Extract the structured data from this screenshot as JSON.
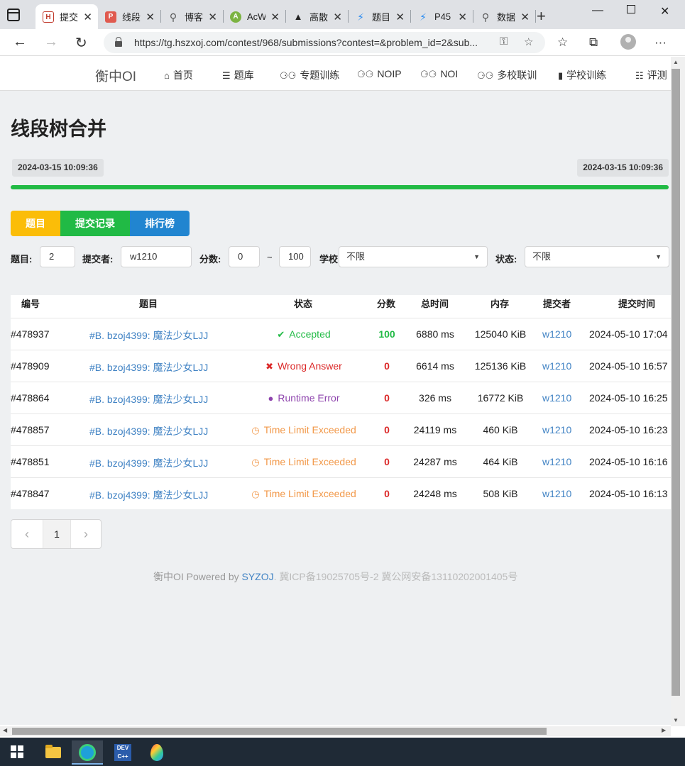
{
  "browser": {
    "tabs": [
      {
        "label": "提交",
        "favicon_color": "#c0392b"
      },
      {
        "label": "线段",
        "favicon_color": "#e05a4f"
      },
      {
        "label": "博客",
        "favicon_color": "#555555"
      },
      {
        "label": "AcW",
        "favicon_color": "#7cb342"
      },
      {
        "label": "高散",
        "favicon_color": "#222222"
      },
      {
        "label": "题目",
        "favicon_color": "#2d8cf0"
      },
      {
        "label": "P45",
        "favicon_color": "#2d8cf0"
      },
      {
        "label": "数据",
        "favicon_color": "#555555"
      }
    ],
    "url": "https://tg.hszxoj.com/contest/968/submissions?contest=&problem_id=2&sub..."
  },
  "site": {
    "brand": "衡中OI",
    "nav": [
      {
        "label": "首页",
        "icon": "home-icon"
      },
      {
        "label": "题库",
        "icon": "list-icon"
      },
      {
        "label": "专题训练",
        "icon": "bicycle-icon"
      },
      {
        "label": "NOIP",
        "icon": "bicycle-icon"
      },
      {
        "label": "NOI",
        "icon": "bicycle-icon"
      },
      {
        "label": "多校联训",
        "icon": "bicycle-icon"
      },
      {
        "label": "学校训练",
        "icon": "building-icon"
      },
      {
        "label": "评测",
        "icon": "tasks-icon"
      }
    ]
  },
  "contest": {
    "title": "线段树合并",
    "start_time": "2024-03-15 10:09:36",
    "end_time": "2024-03-15 10:09:36",
    "progress": 1.0
  },
  "tabs": {
    "problems": "题目",
    "submissions": "提交记录",
    "ranklist": "排行榜"
  },
  "filters": {
    "problem_label": "题目:",
    "problem_value": "2",
    "submitter_label": "提交者:",
    "submitter_value": "w1210",
    "score_label": "分数:",
    "score_min": "0",
    "score_sep": "~",
    "score_max": "100",
    "school_label": "学校",
    "school_value": "不限",
    "status_label": "状态:",
    "status_value": "不限"
  },
  "table": {
    "headers": {
      "id": "编号",
      "problem": "题目",
      "status": "状态",
      "score": "分数",
      "time": "总时间",
      "memory": "内存",
      "submitter": "提交者",
      "submit_time": "提交时间"
    },
    "rows": [
      {
        "id": "#478937",
        "problem": "#B. bzoj4399: 魔法少女LJJ",
        "status": "Accepted",
        "status_color": "#21ba45",
        "status_icon": "check-icon",
        "score": "100",
        "score_color": "#21ba45",
        "time": "6880 ms",
        "memory": "125040 KiB",
        "submitter": "w1210",
        "submit_time": "2024-05-10 17:04"
      },
      {
        "id": "#478909",
        "problem": "#B. bzoj4399: 魔法少女LJJ",
        "status": "Wrong Answer",
        "status_color": "#db2828",
        "status_icon": "cross-icon",
        "score": "0",
        "score_color": "#db2828",
        "time": "6614 ms",
        "memory": "125136 KiB",
        "submitter": "w1210",
        "submit_time": "2024-05-10 16:57"
      },
      {
        "id": "#478864",
        "problem": "#B. bzoj4399: 魔法少女LJJ",
        "status": "Runtime Error",
        "status_color": "#8e44ad",
        "status_icon": "bomb-icon",
        "score": "0",
        "score_color": "#db2828",
        "time": "326 ms",
        "memory": "16772 KiB",
        "submitter": "w1210",
        "submit_time": "2024-05-10 16:25"
      },
      {
        "id": "#478857",
        "problem": "#B. bzoj4399: 魔法少女LJJ",
        "status": "Time Limit Exceeded",
        "status_color": "#f2994a",
        "status_icon": "clock-icon",
        "score": "0",
        "score_color": "#db2828",
        "time": "24119 ms",
        "memory": "460 KiB",
        "submitter": "w1210",
        "submit_time": "2024-05-10 16:23"
      },
      {
        "id": "#478851",
        "problem": "#B. bzoj4399: 魔法少女LJJ",
        "status": "Time Limit Exceeded",
        "status_color": "#f2994a",
        "status_icon": "clock-icon",
        "score": "0",
        "score_color": "#db2828",
        "time": "24287 ms",
        "memory": "464 KiB",
        "submitter": "w1210",
        "submit_time": "2024-05-10 16:16"
      },
      {
        "id": "#478847",
        "problem": "#B. bzoj4399: 魔法少女LJJ",
        "status": "Time Limit Exceeded",
        "status_color": "#f2994a",
        "status_icon": "clock-icon",
        "score": "0",
        "score_color": "#db2828",
        "time": "24248 ms",
        "memory": "508 KiB",
        "submitter": "w1210",
        "submit_time": "2024-05-10 16:13"
      }
    ]
  },
  "pagination": {
    "current": "1"
  },
  "footer": {
    "prefix": "衡中OI Powered by ",
    "link": "SYZOJ",
    "icp": ". 冀ICP备19025705号-2 冀公网安备13110202001405号"
  },
  "colors": {
    "accent_yellow": "#fbbd08",
    "accent_green": "#21ba45",
    "accent_blue": "#2185d0",
    "link": "#4183c4"
  }
}
